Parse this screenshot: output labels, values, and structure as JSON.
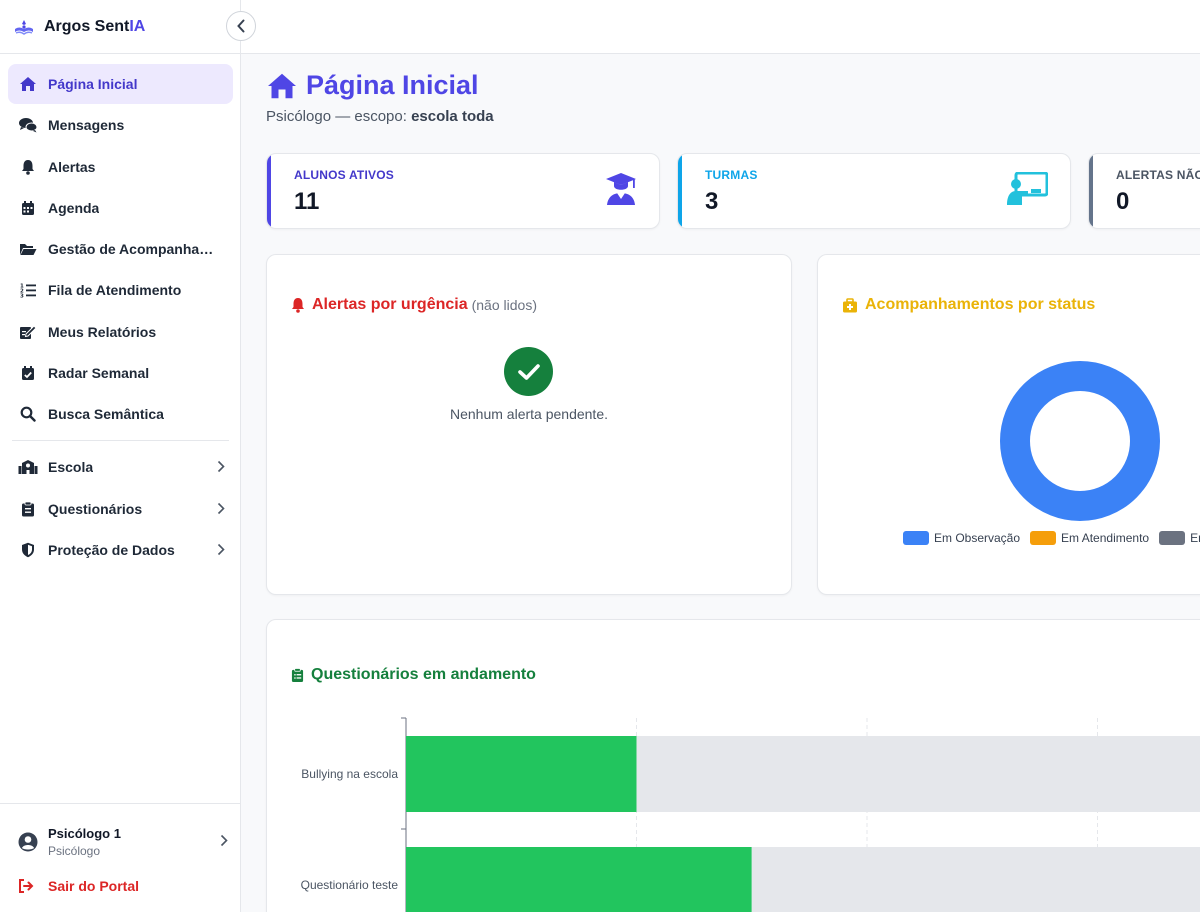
{
  "brand": {
    "name_main": "Argos Sent",
    "name_accent": "IA"
  },
  "nav": {
    "items": [
      {
        "label": "Página Inicial",
        "icon": "home-icon",
        "active": true
      },
      {
        "label": "Mensagens",
        "icon": "chat-icon"
      },
      {
        "label": "Alertas",
        "icon": "bell-icon"
      },
      {
        "label": "Agenda",
        "icon": "calendar-icon"
      },
      {
        "label": "Gestão de Acompanhamentos",
        "icon": "folder-open-icon"
      },
      {
        "label": "Fila de Atendimento",
        "icon": "list-ordered-icon"
      },
      {
        "label": "Meus Relatórios",
        "icon": "edit-report-icon"
      },
      {
        "label": "Radar Semanal",
        "icon": "calendar-check-icon"
      },
      {
        "label": "Busca Semântica",
        "icon": "search-icon"
      }
    ],
    "groups": [
      {
        "label": "Escola",
        "icon": "school-icon"
      },
      {
        "label": "Questionários",
        "icon": "clipboard-icon"
      },
      {
        "label": "Proteção de Dados",
        "icon": "shield-icon"
      }
    ]
  },
  "user": {
    "name": "Psicólogo 1",
    "role": "Psicólogo",
    "logout_label": "Sair do Portal"
  },
  "header": {
    "title": "Página Inicial",
    "subtitle_prefix": "Psicólogo — escopo: ",
    "subtitle_scope": "escola toda"
  },
  "stats": [
    {
      "label": "ALUNOS ATIVOS",
      "value": "11",
      "color": "#4f46e5"
    },
    {
      "label": "TURMAS",
      "value": "3",
      "color": "#0ea5e9"
    },
    {
      "label": "ALERTAS NÃO LIDOS",
      "value": "0",
      "color": "#64748b"
    }
  ],
  "alerts_panel": {
    "title": "Alertas por urgência",
    "title_suffix": "(não lidos)",
    "empty_text": "Nenhum alerta pendente."
  },
  "status_panel": {
    "title": "Acompanhamentos por status",
    "chart_data": {
      "type": "pie",
      "variant": "doughnut",
      "categories": [
        "Em Observação",
        "Em Atendimento",
        "Encerrado"
      ],
      "values": [
        1,
        0,
        0
      ],
      "colors": [
        "#3b82f6",
        "#f59e0b",
        "#6b7280"
      ],
      "legend": "bottom"
    }
  },
  "questionnaires_panel": {
    "title": "Questionários em andamento",
    "chart_data": {
      "type": "bar",
      "orientation": "horizontal",
      "stacked": true,
      "categories": [
        "Bullying na escola",
        "Questionário teste"
      ],
      "series": [
        {
          "values": [
            25,
            37.5
          ],
          "color": "#22c55e"
        },
        {
          "values": [
            75,
            62.5
          ],
          "color": "#e5e7eb"
        }
      ],
      "xlim": [
        0,
        100
      ],
      "grid": true
    }
  },
  "colors": {
    "primary": "#4f46e5",
    "danger": "#dc2626",
    "warning": "#eab308",
    "success": "#15803d"
  }
}
